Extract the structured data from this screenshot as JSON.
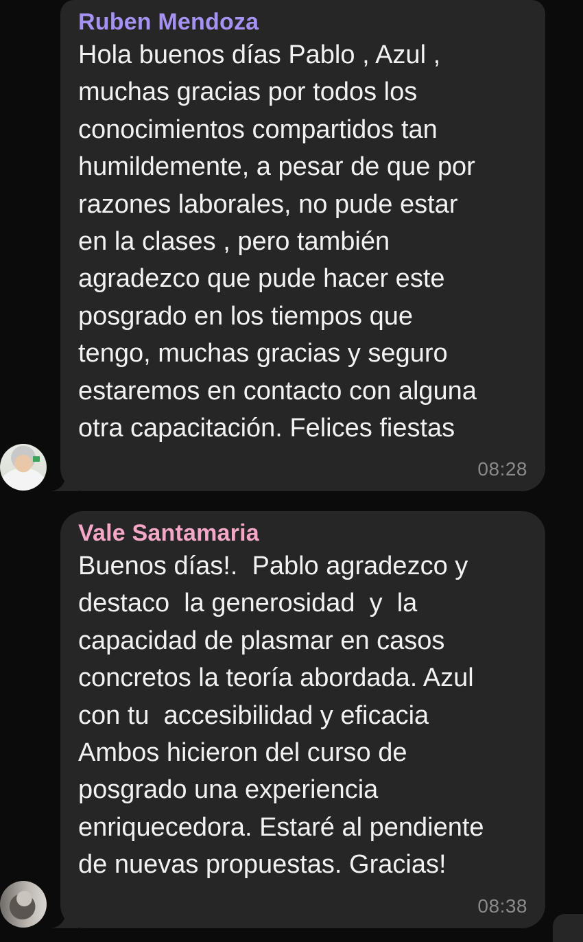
{
  "messages": [
    {
      "sender": "Ruben Mendoza",
      "sender_color": "#a592f2",
      "text": "Hola buenos días Pablo , Azul ,\nmuchas gracias por todos los\nconocimientos compartidos tan\nhumildemente, a pesar de que por\nrazones laborales, no pude estar\nen la clases , pero también\nagradezco que pude hacer este\nposgrado en los tiempos que\ntengo, muchas gracias y seguro\nestaremos en contacto con alguna\notra capacitación. Felices fiestas",
      "time": "08:28",
      "avatar": "avatar-man-photo"
    },
    {
      "sender": "Vale Santamaria",
      "sender_color": "#f4a7c7",
      "text": "Buenos días!.  Pablo agradezco y\ndestaco  la generosidad  y  la\ncapacidad de plasmar en casos\nconcretos la teoría abordada. Azul\ncon tu  accesibilidad y eficacia\nAmbos hicieron del curso de\nposgrado una experiencia\nenriquecedora. Estaré al pendiente\nde nuevas propuestas. Gracias!",
      "time": "08:38",
      "avatar": "avatar-woman-photo"
    }
  ],
  "colors": {
    "background": "#0b0b0b",
    "bubble": "#262626",
    "text": "#f2f2f2",
    "time": "#8a8a8a"
  }
}
